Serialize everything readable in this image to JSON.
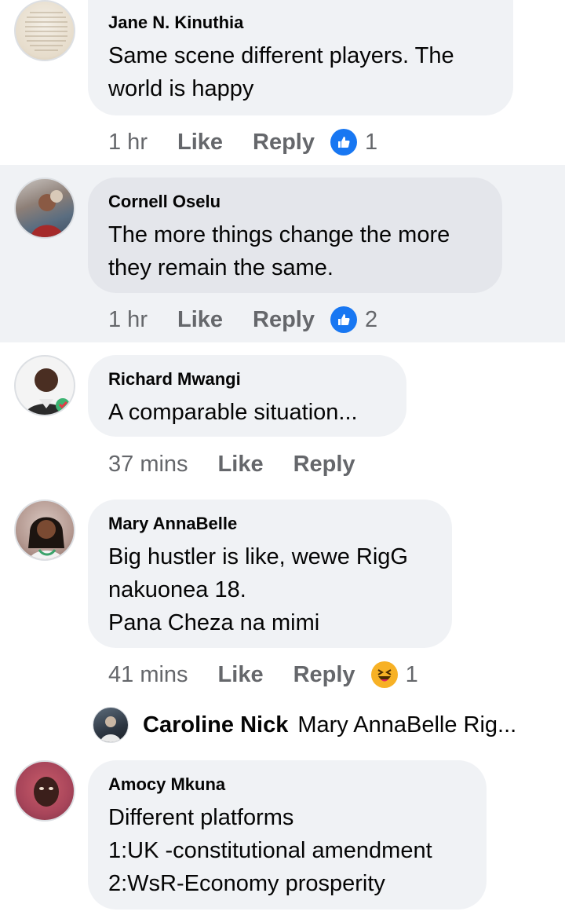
{
  "comments": [
    {
      "author": "Jane N. Kinuthia",
      "text": "Same scene  different players. The\nworld is happy",
      "time": "1 hr",
      "like_label": "Like",
      "reply_label": "Reply",
      "reaction_icon": "like-icon",
      "reaction_count": "1"
    },
    {
      "author": "Cornell Oselu",
      "text": "The more things change the more\nthey remain the same.",
      "time": "1 hr",
      "like_label": "Like",
      "reply_label": "Reply",
      "reaction_icon": "like-icon",
      "reaction_count": "2"
    },
    {
      "author": "Richard Mwangi",
      "text": "A comparable situation...",
      "time": "37 mins",
      "like_label": "Like",
      "reply_label": "Reply"
    },
    {
      "author": "Mary AnnaBelle",
      "text": "Big hustler is like, wewe RigG\nnakuonea 18.\nPana Cheza na mimi",
      "time": "41 mins",
      "like_label": "Like",
      "reply_label": "Reply",
      "reaction_icon": "haha-icon",
      "reaction_count": "1",
      "reply_preview": {
        "author": "Caroline Nick",
        "text": "Mary AnnaBelle Rig..."
      }
    },
    {
      "author": "Amocy Mkuna",
      "text": "Different platforms\n1:UK -constitutional amendment\n2:WsR-Economy prosperity"
    }
  ],
  "colors": {
    "like_blue": "#1877f2",
    "haha_yellow": "#f7b125",
    "bubble_gray": "#f0f2f5",
    "meta_gray": "#65676b"
  }
}
